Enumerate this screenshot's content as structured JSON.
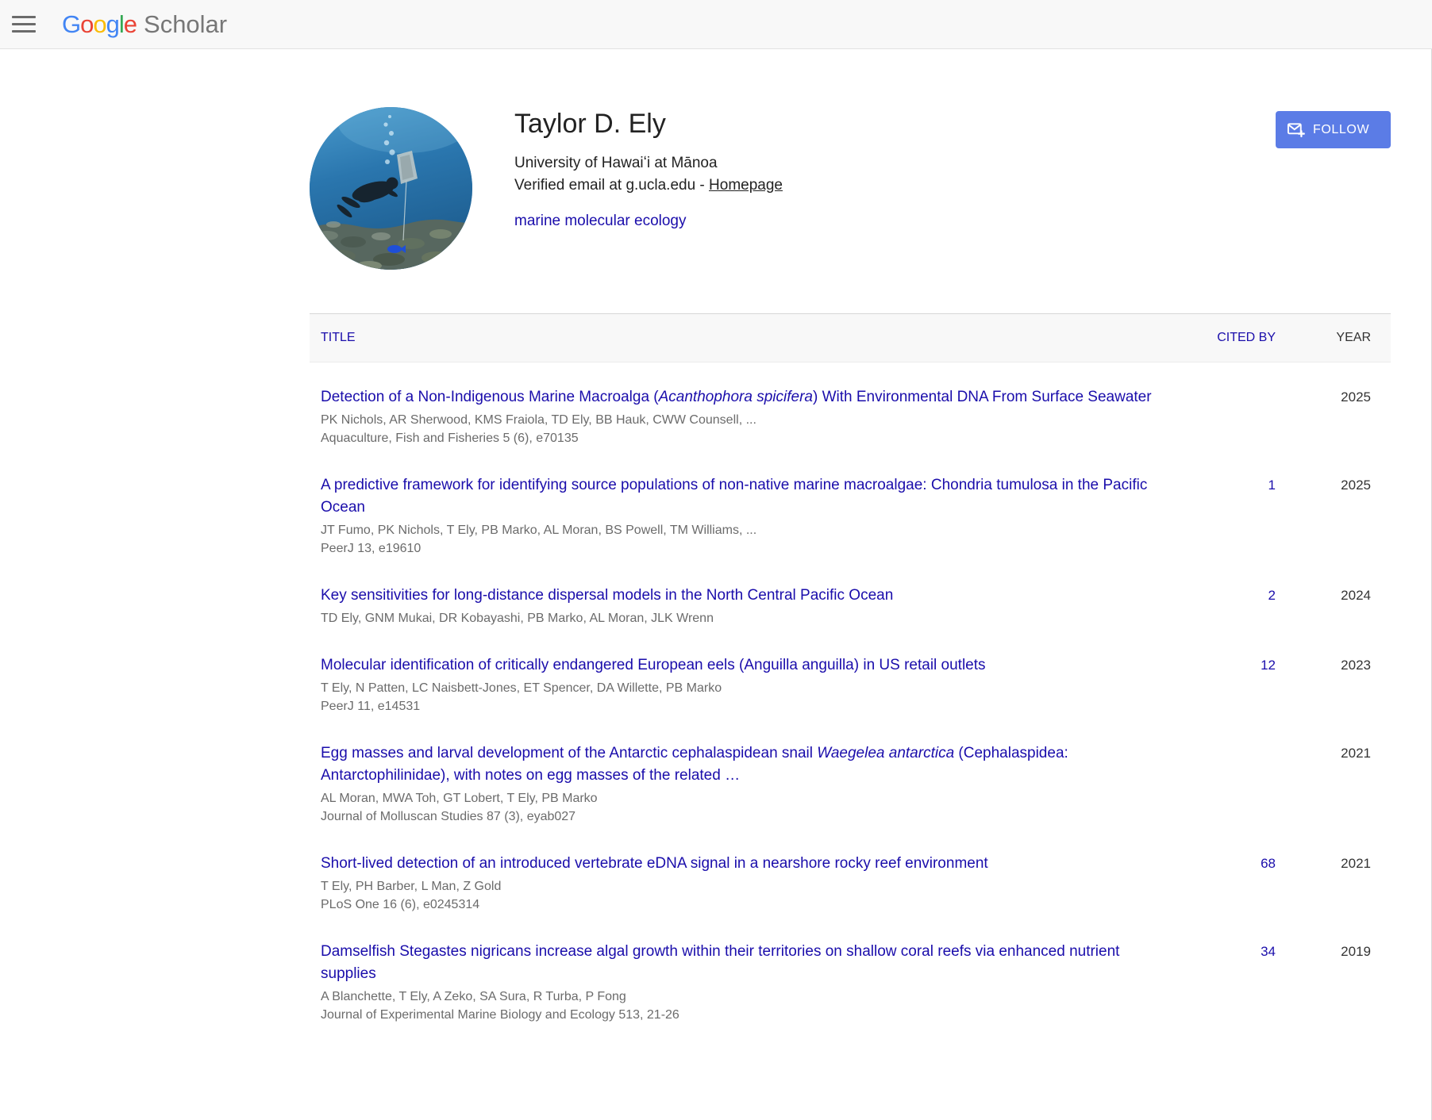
{
  "header": {
    "logo_letters": [
      {
        "ch": "G",
        "color": "#4285F4"
      },
      {
        "ch": "o",
        "color": "#EA4335"
      },
      {
        "ch": "o",
        "color": "#FBBC05"
      },
      {
        "ch": "g",
        "color": "#4285F4"
      },
      {
        "ch": "l",
        "color": "#34A853"
      },
      {
        "ch": "e",
        "color": "#EA4335"
      }
    ],
    "logo_scholar": "Scholar"
  },
  "profile": {
    "name": "Taylor D. Ely",
    "affiliation": "University of Hawaiʻi at Mānoa",
    "verified_email_prefix": "Verified email at g.ucla.edu - ",
    "homepage_label": "Homepage",
    "interest": "marine molecular ecology",
    "follow_label": "FOLLOW"
  },
  "table": {
    "headers": {
      "title": "TITLE",
      "cited_by": "CITED BY",
      "year": "YEAR"
    },
    "rows": [
      {
        "title_parts": [
          {
            "text": "Detection of a Non-Indigenous Marine Macroalga (",
            "italic": false
          },
          {
            "text": "Acanthophora spicifera",
            "italic": true
          },
          {
            "text": ") With Environmental DNA From Surface Seawater",
            "italic": false
          }
        ],
        "authors": "PK Nichols, AR Sherwood, KMS Fraiola, TD Ely, BB Hauk, CWW Counsell, ...",
        "venue": "Aquaculture, Fish and Fisheries 5 (6), e70135",
        "cited_by": "",
        "year": "2025"
      },
      {
        "title_parts": [
          {
            "text": "A predictive framework for identifying source populations of non-native marine macroalgae: Chondria tumulosa in the Pacific Ocean",
            "italic": false
          }
        ],
        "authors": "JT Fumo, PK Nichols, T Ely, PB Marko, AL Moran, BS Powell, TM Williams, ...",
        "venue": "PeerJ 13, e19610",
        "cited_by": "1",
        "year": "2025"
      },
      {
        "title_parts": [
          {
            "text": "Key sensitivities for long-distance dispersal models in the North Central Pacific Ocean",
            "italic": false
          }
        ],
        "authors": "TD Ely, GNM Mukai, DR Kobayashi, PB Marko, AL Moran, JLK Wrenn",
        "venue": "",
        "cited_by": "2",
        "year": "2024"
      },
      {
        "title_parts": [
          {
            "text": "Molecular identification of critically endangered European eels (Anguilla anguilla) in US retail outlets",
            "italic": false
          }
        ],
        "authors": "T Ely, N Patten, LC Naisbett-Jones, ET Spencer, DA Willette, PB Marko",
        "venue": "PeerJ 11, e14531",
        "cited_by": "12",
        "year": "2023"
      },
      {
        "title_parts": [
          {
            "text": "Egg masses and larval development of the Antarctic cephalaspidean snail ",
            "italic": false
          },
          {
            "text": "Waegelea antarctica",
            "italic": true
          },
          {
            "text": " (Cephalaspidea: Antarctophilinidae), with notes on egg masses of the related …",
            "italic": false
          }
        ],
        "authors": "AL Moran, MWA Toh, GT Lobert, T Ely, PB Marko",
        "venue": "Journal of Molluscan Studies 87 (3), eyab027",
        "cited_by": "",
        "year": "2021"
      },
      {
        "title_parts": [
          {
            "text": "Short-lived detection of an introduced vertebrate eDNA signal in a nearshore rocky reef environment",
            "italic": false
          }
        ],
        "authors": "T Ely, PH Barber, L Man, Z Gold",
        "venue": "PLoS One 16 (6), e0245314",
        "cited_by": "68",
        "year": "2021"
      },
      {
        "title_parts": [
          {
            "text": "Damselfish Stegastes nigricans increase algal growth within their territories on shallow coral reefs via enhanced nutrient supplies",
            "italic": false
          }
        ],
        "authors": "A Blanchette, T Ely, A Zeko, SA Sura, R Turba, P Fong",
        "venue": "Journal of Experimental Marine Biology and Ecology 513, 21-26",
        "cited_by": "34",
        "year": "2019"
      }
    ]
  },
  "colors": {
    "link_blue": "#1a0dab",
    "follow_button_blue": "#5b7ce6",
    "header_bg": "#f8f8f8",
    "muted_text": "#6b6b6b"
  }
}
